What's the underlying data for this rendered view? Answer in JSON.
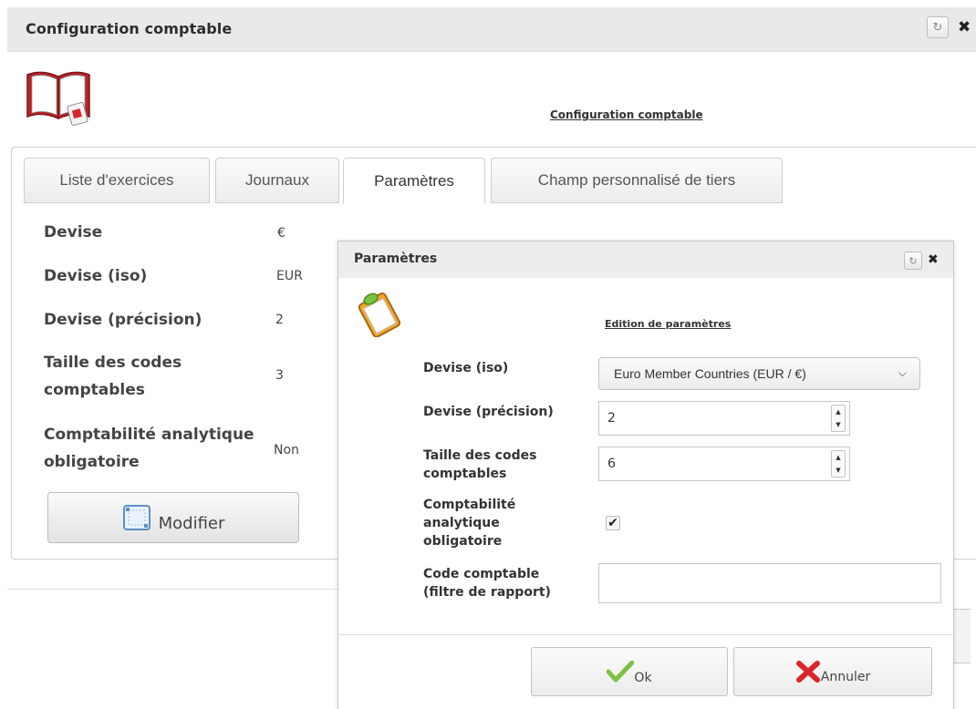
{
  "window": {
    "title": "Configuration comptable",
    "heading": "Configuration comptable"
  },
  "tabs": [
    {
      "label": "Liste d'exercices",
      "active": false
    },
    {
      "label": "Journaux",
      "active": false
    },
    {
      "label": "Paramètres",
      "active": true
    },
    {
      "label": "Champ personnalisé de tiers",
      "active": false
    }
  ],
  "params": [
    {
      "label": "Devise",
      "value": "€"
    },
    {
      "label": "Devise (iso)",
      "value": "EUR"
    },
    {
      "label": "Devise (précision)",
      "value": "2"
    },
    {
      "label": "Taille des codes comptables",
      "value": "3"
    },
    {
      "label": "Comptabilité analytique obligatoire",
      "value": "Non"
    }
  ],
  "modify_button": {
    "label": "Modifier",
    "icon": "edit-frame-icon"
  },
  "dialog": {
    "title": "Paramètres",
    "heading": "Edition de paramètres",
    "fields": {
      "currency_iso": {
        "label": "Devise (iso)",
        "value": "Euro Member Countries (EUR / €)"
      },
      "precision": {
        "label": "Devise (précision)",
        "value": "2"
      },
      "code_size": {
        "label": "Taille des codes comptables",
        "value": "6"
      },
      "analytic_required": {
        "label": "Comptabilité analytique obligatoire",
        "checked": true
      },
      "report_filter": {
        "label": "Code comptable (filtre de rapport)",
        "value": ""
      }
    },
    "ok_label": "Ok",
    "cancel_label": "Annuler"
  },
  "colors": {
    "titlebar": "#e9e9e9",
    "ok_green": "#7cc242",
    "cancel_red": "#d9262b",
    "book_red": "#b52328"
  }
}
